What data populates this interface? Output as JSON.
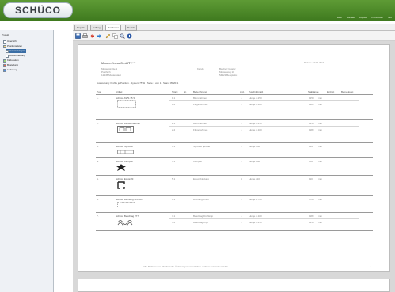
{
  "app": {
    "logo_text": "SCHÜCO",
    "header_links": [
      "Hilfe",
      "Kontakt",
      "Logout",
      "Impressum",
      "Info"
    ],
    "brand_color": "#4b8a29"
  },
  "tabs": [
    "Projekte",
    "Auftrag",
    "Positionen",
    "Details"
  ],
  "toolbar_icons": [
    "save-icon",
    "print-icon",
    "undo-icon",
    "redo-icon",
    "edit-icon",
    "copy-icon",
    "zoom-icon",
    "help-icon"
  ],
  "sidebar": {
    "title": "Projekt",
    "items": [
      {
        "label": "Übersicht",
        "depth": 0,
        "selected": false
      },
      {
        "label": "Positionslisten",
        "depth": 0,
        "selected": false
      },
      {
        "label": "Auswertungen",
        "depth": 1,
        "selected": true
      },
      {
        "label": "Ausschreibung",
        "depth": 1,
        "selected": false
      },
      {
        "label": "Kalkulation",
        "depth": 0,
        "selected": false
      },
      {
        "label": "Bestellung",
        "depth": 0,
        "selected": false
      },
      {
        "label": "Lieferung",
        "depth": 0,
        "selected": false
      }
    ]
  },
  "document": {
    "company": "Musterfirma GmbH",
    "project_label": "Projekt",
    "address_lines": [
      "Musterstraße 1",
      "Postfach",
      "12345 Musterstadt"
    ],
    "customer_label": "Kunde",
    "customer_lines": [
      "Bauherr Muster",
      "Musterweg 10",
      "54321 Beispielort"
    ],
    "date_label": "Datum: 17.05.2011",
    "summary_line": "Auswertung: Profile je Position · System 75 SI · Seite 1 von 1 · Stand 05/2011",
    "columns": [
      "Pos.",
      "Artikel",
      "Stück",
      "Nr.",
      "Bezeichnung",
      "Anz.",
      "Zuschnittmaß",
      "Stablänge",
      "Einheit",
      "Bemerkung"
    ],
    "rows": [
      {
        "pos": "1.",
        "article": "Schüco AWS 75 SI",
        "shape": "frame",
        "lines": [
          {
            "qty": "1.1",
            "desc": "Blendrahmen",
            "count": "1",
            "cut": "Länge 1.250",
            "len": "1250",
            "unit": "mm"
          },
          {
            "qty": "1.2",
            "desc": "Flügelrahmen",
            "count": "1",
            "cut": "Länge 1.180",
            "len": "1180",
            "unit": "mm"
          }
        ]
      },
      {
        "pos": "2.",
        "article": "Schüco Fensterrahmen",
        "shape": "box",
        "lines": [
          {
            "qty": "2.1",
            "desc": "Blendrahmen",
            "count": "1",
            "cut": "Länge 1.250",
            "len": "1250",
            "unit": "mm"
          },
          {
            "qty": "2.2",
            "desc": "Flügelrahmen",
            "count": "1",
            "cut": "Länge 1.180",
            "len": "1180",
            "unit": "mm"
          }
        ]
      },
      {
        "pos": "3.",
        "article": "Schüco Sprosse",
        "shape": "bar",
        "lines": [
          {
            "qty": "3.1",
            "desc": "Sprosse gerade",
            "count": "2",
            "cut": "Länge 840",
            "len": "840",
            "unit": "mm"
          }
        ]
      },
      {
        "pos": "4.",
        "article": "Schüco Kämpfer",
        "shape": "cross",
        "lines": [
          {
            "qty": "4.1",
            "desc": "Kämpfer",
            "count": "1",
            "cut": "Länge 980",
            "len": "980",
            "unit": "mm"
          }
        ]
      },
      {
        "pos": "5.",
        "article": "Schüco Eckprofil",
        "shape": "corner",
        "lines": [
          {
            "qty": "5.1",
            "desc": "Eckverbindung",
            "count": "4",
            "cut": "Länge 110",
            "len": "110",
            "unit": "mm"
          }
        ]
      },
      {
        "pos": "6.",
        "article": "Schüco Dichtung 224 085",
        "shape": "dashed",
        "lines": [
          {
            "qty": "6.1",
            "desc": "Dichtung innen",
            "count": "1",
            "cut": "Länge 4.700",
            "len": "4700",
            "unit": "mm"
          }
        ]
      },
      {
        "pos": "7.",
        "article": "Schüco Beschlag 277",
        "shape": "wave",
        "lines": [
          {
            "qty": "7.1",
            "desc": "Beschlag Drehkipp",
            "count": "1",
            "cut": "Länge 1.180",
            "len": "1180",
            "unit": "mm"
          },
          {
            "qty": "7.2",
            "desc": "Beschlag Kipp",
            "count": "1",
            "cut": "Länge 1.250",
            "len": "1250",
            "unit": "mm"
          }
        ]
      }
    ],
    "footer": "Alle Maße in mm. Technische Änderungen vorbehalten. Schüco International KG.",
    "page_number": "1"
  }
}
